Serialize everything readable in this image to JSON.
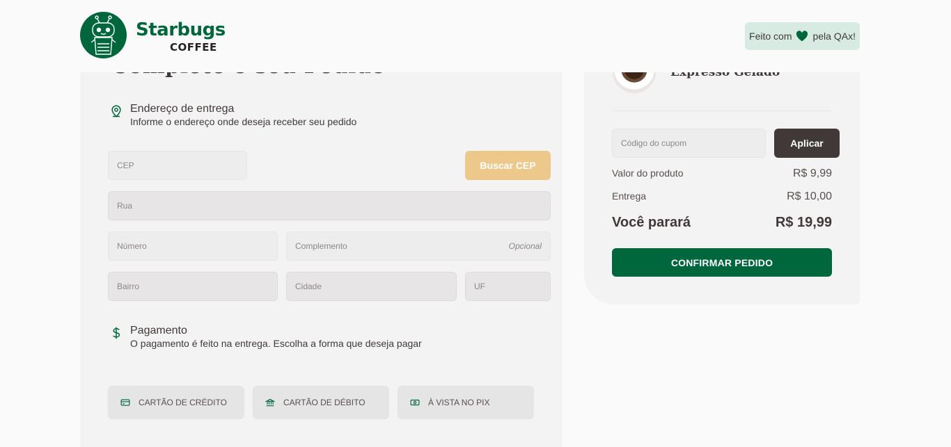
{
  "header": {
    "brand_main": "Starbugs",
    "brand_sub": "COFFEE",
    "made_with_prefix": "Feito com",
    "made_with_suffix": "pela QAx!"
  },
  "checkout": {
    "title": "Complete o seu Pedido",
    "address": {
      "title": "Endereço de entrega",
      "subtitle": "Informe o endereço onde deseja receber seu pedido",
      "cep_placeholder": "CEP",
      "search_cep_label": "Buscar CEP",
      "street_placeholder": "Rua",
      "number_placeholder": "Número",
      "complement_placeholder": "Complemento",
      "complement_optional": "Opcional",
      "district_placeholder": "Bairro",
      "city_placeholder": "Cidade",
      "state_placeholder": "UF"
    },
    "payment": {
      "title": "Pagamento",
      "subtitle": "O pagamento é feito na entrega. Escolha a forma que deseja pagar",
      "options": [
        "CARTÃO DE CRÉDITO",
        "CARTÃO DE DÉBITO",
        "À VISTA NO PIX"
      ]
    }
  },
  "summary": {
    "product_name": "Expresso Gelado",
    "coupon_placeholder": "Código do cupom",
    "apply_label": "Aplicar",
    "product_value_label": "Valor do produto",
    "product_value": "R$ 9,99",
    "delivery_label": "Entrega",
    "delivery_value": "R$ 10,00",
    "total_label": "Você parará",
    "total_value": "R$ 19,99",
    "confirm_label": "CONFIRMAR PEDIDO"
  },
  "colors": {
    "brand_green": "#00673c",
    "brown_dark": "#403937",
    "yellow": "#ecc98b",
    "badge_bg": "#d7ebe3"
  }
}
